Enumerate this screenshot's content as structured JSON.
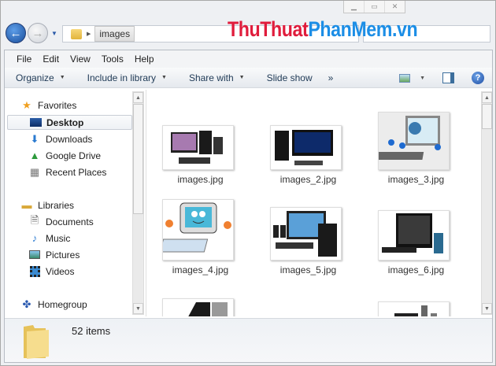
{
  "window": {
    "minimize": "▁",
    "maximize": "▭",
    "close": "✕"
  },
  "watermark": {
    "part1": "ThuThuat",
    "part2": "PhanMem.vn"
  },
  "address": {
    "crumbs": [
      "images"
    ]
  },
  "search": {
    "placeholder": ""
  },
  "menu": [
    "File",
    "Edit",
    "View",
    "Tools",
    "Help"
  ],
  "toolbar": {
    "organize": "Organize",
    "include": "Include in library",
    "share": "Share with",
    "slideshow": "Slide show",
    "more": "»"
  },
  "sidebar": {
    "favorites": "Favorites",
    "fav_items": [
      "Desktop",
      "Downloads",
      "Google Drive",
      "Recent Places"
    ],
    "libraries": "Libraries",
    "lib_items": [
      "Documents",
      "Music",
      "Pictures",
      "Videos"
    ],
    "homegroup": "Homegroup"
  },
  "files": [
    "images.jpg",
    "images_2.jpg",
    "images_3.jpg",
    "images_4.jpg",
    "images_5.jpg",
    "images_6.jpg"
  ],
  "status": {
    "count": "52 items"
  }
}
